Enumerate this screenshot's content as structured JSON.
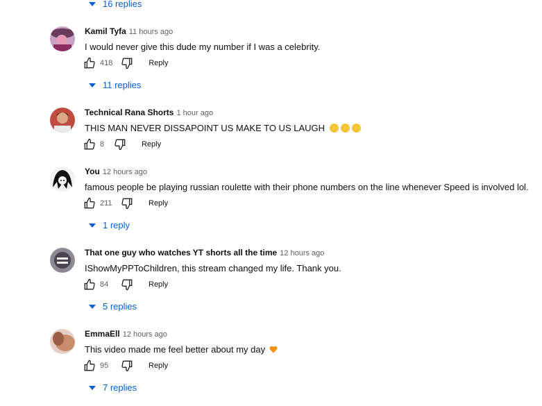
{
  "top_replies": "16 replies",
  "comments": [
    {
      "author": "Kamil Tyfa",
      "time": "11 hours ago",
      "text": "I would never give this dude my number if I was a celebrity.",
      "likes": "418",
      "reply_label": "Reply",
      "replies": "11 replies"
    },
    {
      "author": "Technical Rana Shorts",
      "time": "1 hour ago",
      "text": "THIS MAN NEVER DISSAPOINT US MAKE TO US LAUGH",
      "likes": "8",
      "reply_label": "Reply",
      "replies": ""
    },
    {
      "author": "You",
      "time": "12 hours ago",
      "text": "famous people be playing russian roulette with their phone numbers on the line whenever Speed is involved lol.",
      "likes": "211",
      "reply_label": "Reply",
      "replies": "1 reply"
    },
    {
      "author": "That one guy who watches YT shorts all the time",
      "time": "12 hours ago",
      "text": "IShowMyPPToChildren, this stream changed my life. Thank you.",
      "likes": "84",
      "reply_label": "Reply",
      "replies": "5 replies"
    },
    {
      "author": "EmmaEll",
      "time": "12 hours ago",
      "text": "This video made me feel better about my day",
      "likes": "95",
      "reply_label": "Reply",
      "replies": "7 replies"
    }
  ],
  "colors": {
    "link": "#065fd4",
    "meta": "#606060",
    "text": "#0f0f0f"
  }
}
